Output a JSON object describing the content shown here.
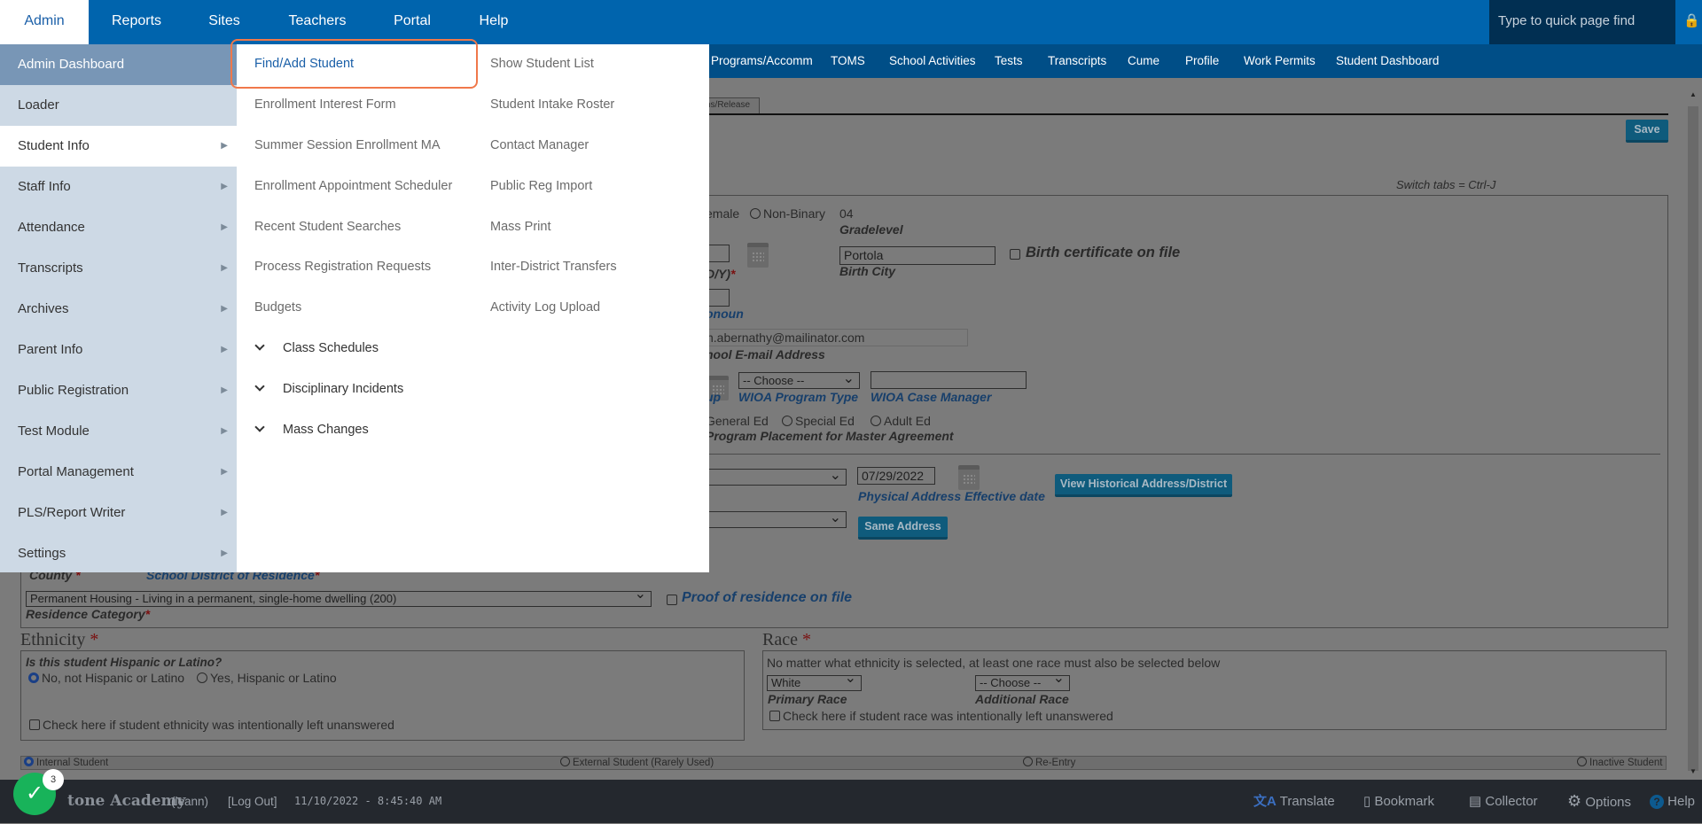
{
  "topnav": {
    "items": [
      "Admin",
      "Reports",
      "Sites",
      "Teachers",
      "Portal",
      "Help"
    ],
    "active": "Admin",
    "quick_find_placeholder": "Type to quick page find",
    "lock_icon": "lock-icon"
  },
  "subnav": {
    "items": [
      "Programs/Accomm",
      "TOMS",
      "School Activities",
      "Tests",
      "Transcripts",
      "Cume",
      "Profile",
      "Work Permits",
      "Student Dashboard"
    ]
  },
  "left_menu": {
    "items": [
      {
        "label": "Admin Dashboard",
        "arrow": false
      },
      {
        "label": "Loader",
        "arrow": false
      },
      {
        "label": "Student Info",
        "arrow": true
      },
      {
        "label": "Staff Info",
        "arrow": true
      },
      {
        "label": "Attendance",
        "arrow": true
      },
      {
        "label": "Transcripts",
        "arrow": true
      },
      {
        "label": "Archives",
        "arrow": true
      },
      {
        "label": "Parent Info",
        "arrow": true
      },
      {
        "label": "Public Registration",
        "arrow": true
      },
      {
        "label": "Test Module",
        "arrow": true
      },
      {
        "label": "Portal Management",
        "arrow": true
      },
      {
        "label": "PLS/Report Writer",
        "arrow": true
      },
      {
        "label": "Settings",
        "arrow": true
      }
    ],
    "active": "Student Info"
  },
  "flyout": {
    "col1": [
      "Find/Add Student",
      "Enrollment Interest Form",
      "Summer Session Enrollment MA",
      "Enrollment Appointment Scheduler",
      "Recent Student Searches",
      "Process Registration Requests",
      "Budgets"
    ],
    "col1_groups": [
      "Class Schedules",
      "Disciplinary Incidents",
      "Mass Changes"
    ],
    "col2": [
      "Show Student List",
      "Student Intake Roster",
      "Contact Manager",
      "Public Reg Import",
      "Mass Print",
      "Inter-District Transfers",
      "Activity Log Upload"
    ],
    "highlighted": "Find/Add Student",
    "highlight_color": "#f0784a"
  },
  "form": {
    "tab_partial": "ns/Release",
    "save": "Save",
    "switch_tabs": "Switch tabs = Ctrl-J",
    "gender_partial": "emale",
    "gender_nonbinary": "Non-Binary",
    "grade_value": "04",
    "grade_label": "Gradelevel",
    "dob_label_partial": "D/Y)",
    "birth_city_value": "Portola",
    "birth_city_label": "Birth City",
    "birth_cert_label": "Birth certificate on file",
    "pronoun_label_partial": "onoun",
    "email_value": "n.abernathy@mailinator.com",
    "email_label_partial": "hool E-mail Address",
    "group_label_partial": "up",
    "wioa_type_value": "-- Choose --",
    "wioa_type_label": "WIOA Program Type",
    "wioa_manager_label": "WIOA Case Manager",
    "placement_options": [
      "General Ed",
      "Special Ed",
      "Adult Ed"
    ],
    "placement_label_partial": "Program Placement for Master Agreement",
    "effective_date_value": "07/29/2022",
    "effective_date_label": "Physical Address Effective date",
    "view_historical": "View Historical Address/District",
    "same_address": "Same Address",
    "county_label": "County",
    "district_label": "School District of Residence",
    "residence_value": "Permanent Housing - Living in a permanent, single-home dwelling (200)",
    "residence_label": "Residence Category",
    "proof_residence": "Proof of residence on file"
  },
  "ethnicity": {
    "heading": "Ethnicity",
    "question": "Is this student Hispanic or Latino?",
    "options": [
      "No, not Hispanic or Latino",
      "Yes, Hispanic or Latino"
    ],
    "selected": "No, not Hispanic or Latino",
    "unanswered": "Check here if student ethnicity was intentionally left unanswered"
  },
  "race": {
    "heading": "Race",
    "note": "No matter what ethnicity is selected, at least one race must also be selected below",
    "primary_value": "White",
    "primary_label": "Primary Race",
    "additional_value": "-- Choose --",
    "additional_label": "Additional Race",
    "unanswered": "Check here if student race was intentionally left unanswered"
  },
  "student_type": {
    "options": [
      "Internal Student",
      "External Student (Rarely Used)",
      "Re-Entry",
      "Inactive Student"
    ],
    "selected": "Internal Student"
  },
  "bottombar": {
    "school_partial": "tone Academy",
    "user": "(leann)",
    "logout": "[Log Out]",
    "datetime": "11/10/2022 - 8:45:40 AM",
    "actions": [
      "Translate",
      "Bookmark",
      "Collector",
      "Options",
      "Help"
    ],
    "badge_count": "3",
    "check_color": "#18b35a"
  }
}
